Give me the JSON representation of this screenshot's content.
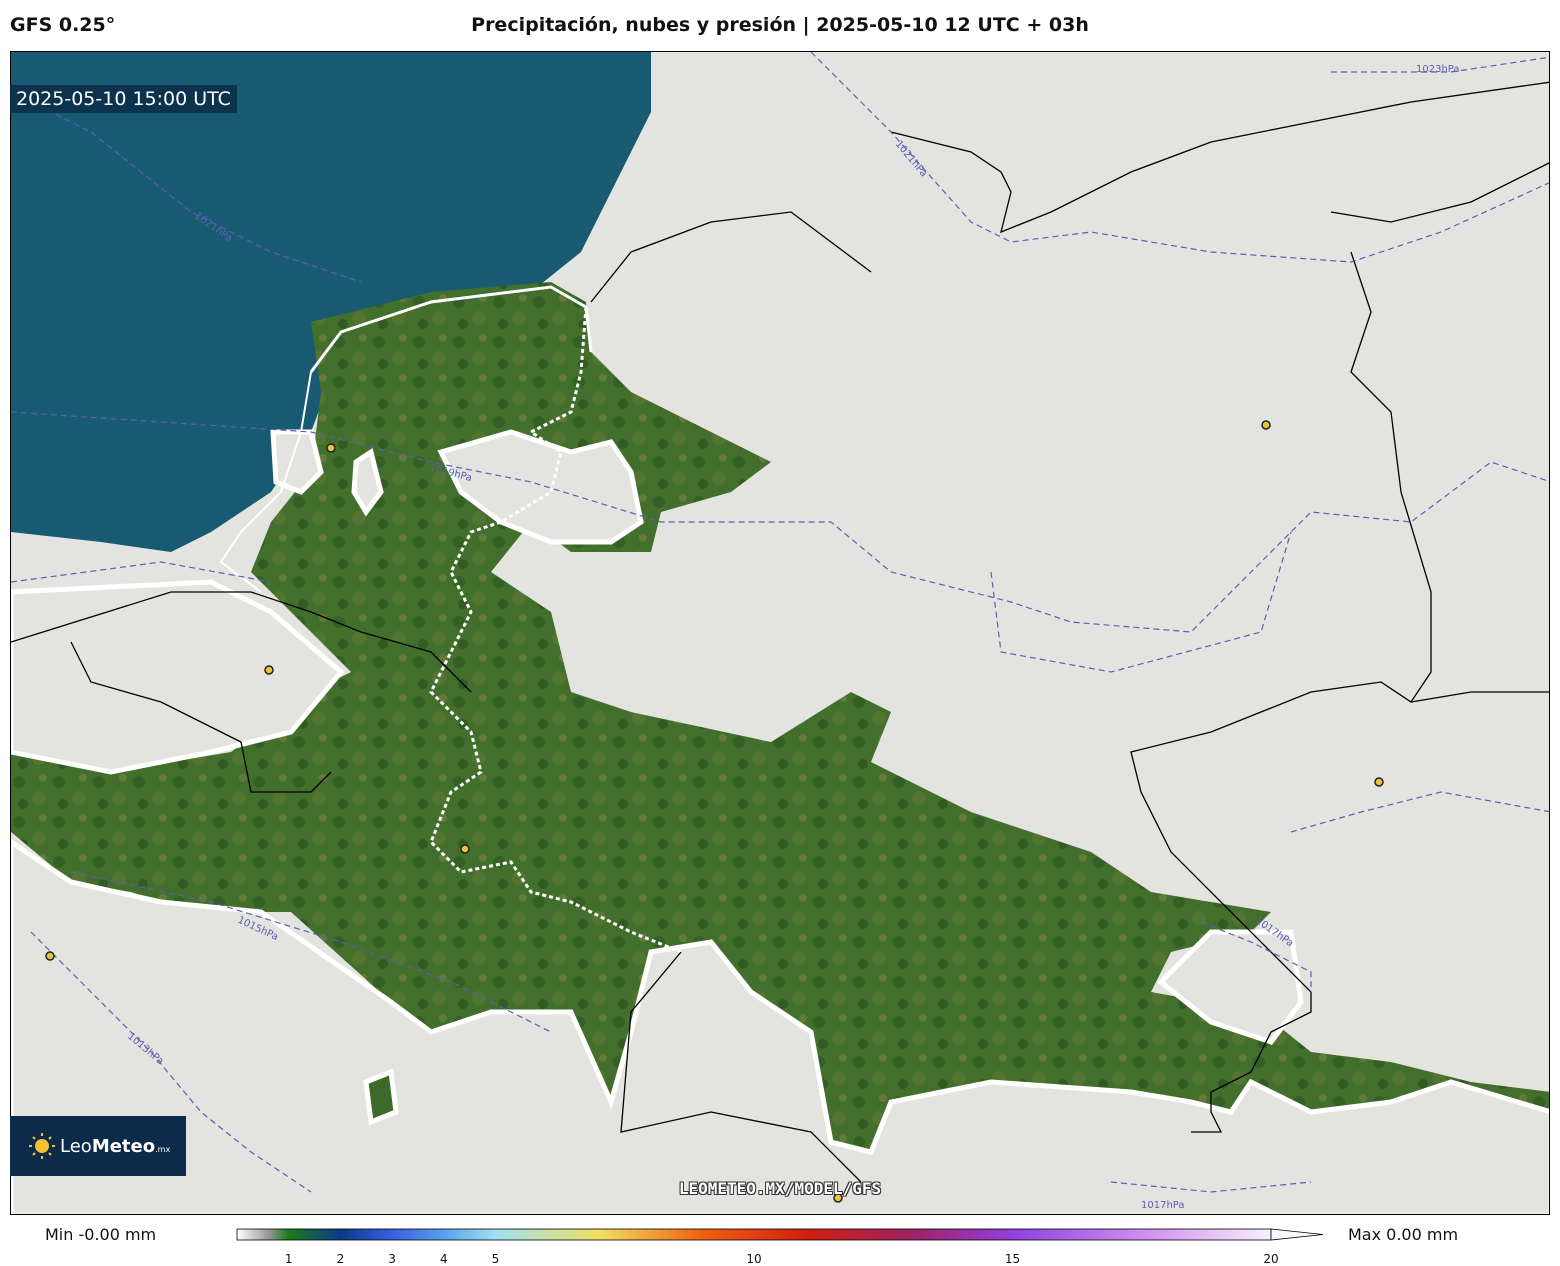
{
  "header": {
    "model": "GFS 0.25°",
    "title": "Precipitación, nubes y presión | 2025-05-10 12 UTC + 03h"
  },
  "map": {
    "timestamp": "2025-05-10 15:00 UTC",
    "isobars": [
      "1023hPa",
      "1021hPa",
      "1021hPa",
      "1019hPa",
      "1017hPa",
      "1015hPa",
      "1013hPa",
      "1017hPa"
    ],
    "watermark": "LEOMETEO.MX/MODEL/GFS",
    "colors": {
      "sea": "#175a72",
      "land": "#3d6a2a",
      "cloud": "#e3e4df",
      "isobar": "#5b5fb0",
      "city": "#e8c43a"
    }
  },
  "logo": {
    "brand_light": "Leo",
    "brand_bold": "Meteo",
    "suffix": ".mx"
  },
  "colorbar": {
    "min_label": "Min -0.00 mm",
    "max_label": "Max 0.00 mm",
    "range": [
      0,
      20
    ],
    "ticks": [
      "1",
      "2",
      "3",
      "4",
      "5",
      "10",
      "15",
      "20"
    ],
    "tick_values": [
      1,
      2,
      3,
      4,
      5,
      10,
      15,
      20
    ]
  }
}
